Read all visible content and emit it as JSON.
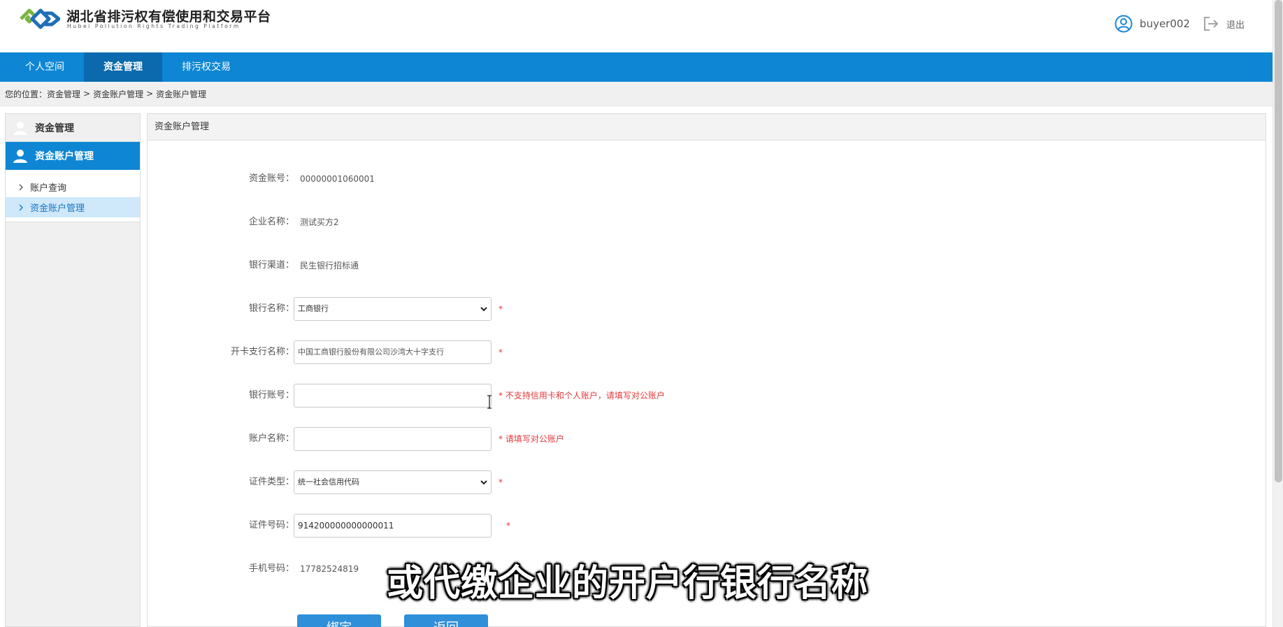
{
  "header": {
    "title": "湖北省排污权有偿使用和交易平台",
    "subtitle": "Hubei Pollution Rights Trading Platform",
    "username": "buyer002",
    "logout_label": "退出",
    "logo_icon": "diamond-chain-logo",
    "user_icon": "user-circle-icon",
    "logout_icon": "logout-arrow-icon"
  },
  "nav": {
    "items": [
      "个人空间",
      "资金管理",
      "排污权交易"
    ],
    "active_index": 1
  },
  "breadcrumb": {
    "prefix": "您的位置：",
    "items": [
      "资金管理",
      "资金账户管理",
      "资金账户管理"
    ],
    "separator": ">"
  },
  "sidebar": {
    "section_title": "资金管理",
    "active_group": "资金账户管理",
    "links": [
      "账户查询",
      "资金账户管理"
    ],
    "selected_index": 1
  },
  "panel": {
    "title": "资金账户管理"
  },
  "form": {
    "account_no": {
      "label": "资金账号：",
      "value": "00000001060001"
    },
    "company_name": {
      "label": "企业名称：",
      "value": "测试买方2"
    },
    "bank_channel": {
      "label": "银行渠道：",
      "value": "民生银行招标通"
    },
    "bank_name": {
      "label": "银行名称：",
      "value": "工商银行",
      "required": "*"
    },
    "branch_name": {
      "label": "开卡支行名称：",
      "value": "中国工商银行股份有限公司沙湾大十字支行",
      "required": "*"
    },
    "bank_account": {
      "label": "银行账号：",
      "value": "",
      "required": "* 不支持信用卡和个人账户，请填写对公账户"
    },
    "account_holder": {
      "label": "账户名称：",
      "value": "",
      "required": "* 请填写对公账户"
    },
    "cert_type": {
      "label": "证件类型：",
      "value": "统一社会信用代码",
      "required": "*"
    },
    "cert_no": {
      "label": "证件号码：",
      "value": "914200000000000011",
      "required": "*"
    },
    "phone": {
      "label": "手机号码：",
      "value": "17782524819"
    }
  },
  "buttons": {
    "bind": "绑定",
    "back": "返回"
  },
  "caption": "或代缴企业的开户行银行名称",
  "colors": {
    "nav_blue": "#0e86d4",
    "nav_active": "#0a6aad",
    "required_red": "#e4393c",
    "button_blue": "#2f8fd9"
  }
}
